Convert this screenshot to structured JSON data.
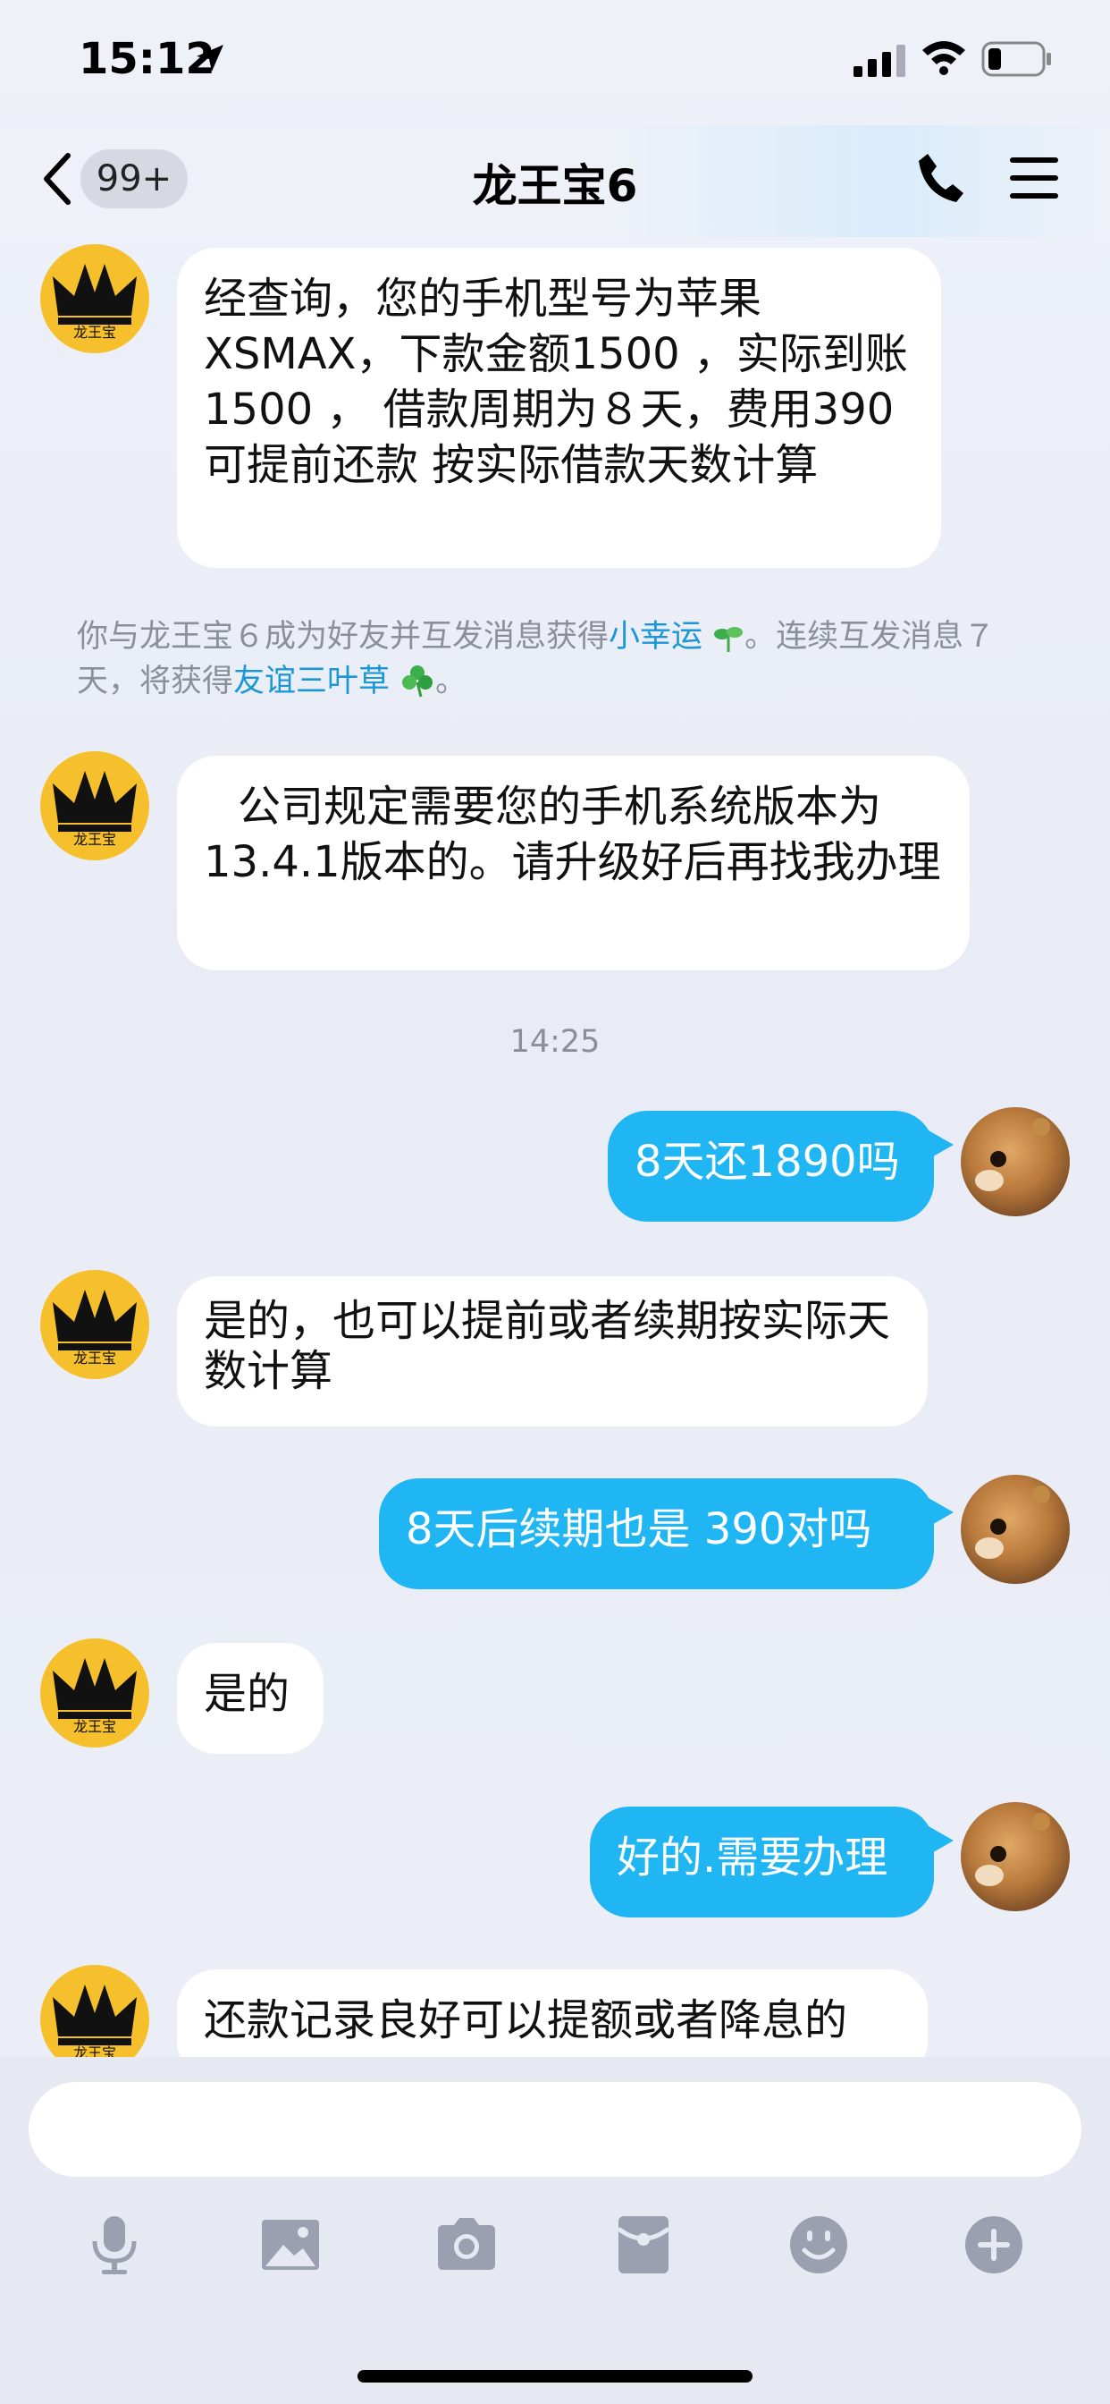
{
  "status_bar": {
    "time": "15:12",
    "icons": [
      "location-arrow-icon",
      "signal-icon",
      "wifi-icon",
      "battery-icon"
    ]
  },
  "header": {
    "back_icon": "chevron-left-icon",
    "unread_badge": "99+",
    "title": "龙王宝6",
    "right_icons": [
      "phone-icon",
      "menu-icon"
    ]
  },
  "messages": [
    {
      "from": "bot",
      "text": "经查询，您的手机型号为苹果XSMAX，下款金额1500 ，实际到账1500 ， 借款周期为８天，费用390 可提前还款 按实际借款天数计算"
    },
    {
      "type": "system",
      "parts": [
        "你与龙王宝６成为好友并互发消息获得",
        "小幸运",
        "。连续互发消息７天，将获得",
        "友谊三叶草",
        "。"
      ]
    },
    {
      "from": "bot",
      "text": "公司规定需要您的手机系统版本为13.4.1版本的。请升级好后再找我办理"
    },
    {
      "type": "time",
      "text": "14:25"
    },
    {
      "from": "me",
      "text": "8天还1890吗"
    },
    {
      "from": "bot",
      "text": "是的，也可以提前或者续期按实际天数计算"
    },
    {
      "from": "me",
      "text": "8天后续期也是 390对吗"
    },
    {
      "from": "bot",
      "text": "是的"
    },
    {
      "from": "me",
      "text": "好的.需要办理"
    },
    {
      "from": "bot",
      "text": "还款记录良好可以提额或者降息的"
    }
  ],
  "bot_avatar_label": "龙王宝",
  "input": {
    "value": "",
    "placeholder": ""
  },
  "toolbar": [
    "microphone-icon",
    "image-icon",
    "camera-icon",
    "red-packet-icon",
    "emoji-icon",
    "plus-icon"
  ],
  "colors": {
    "outgoing_bubble": "#1fb6f3",
    "link": "#1c97d6",
    "avatar_bg": "#f5c02c"
  }
}
